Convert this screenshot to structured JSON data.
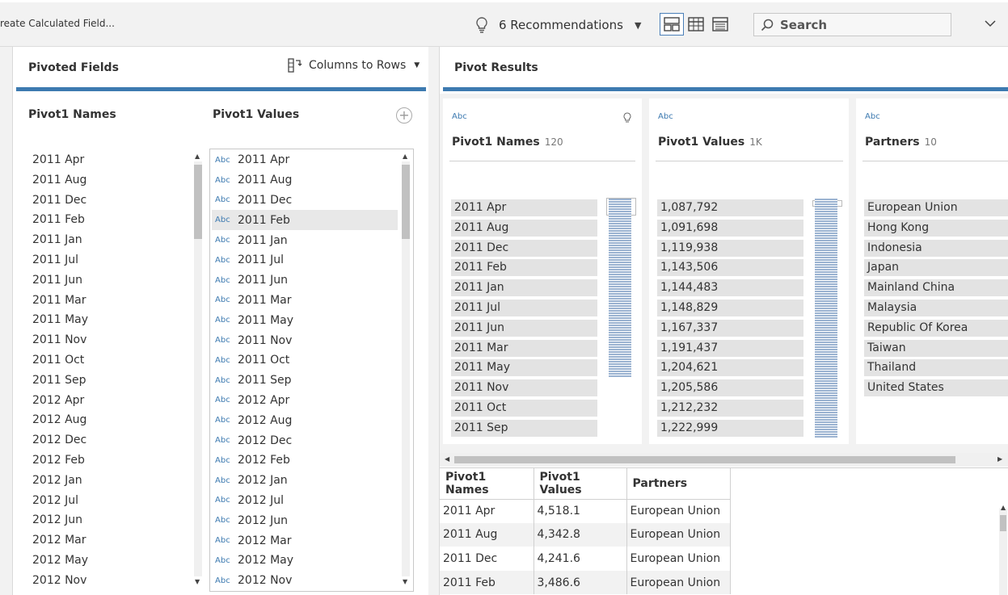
{
  "toolbar": {
    "calc_label": "reate Calculated Field...",
    "recommendations": "6 Recommendations",
    "search_placeholder": "Search"
  },
  "left_pane": {
    "title": "Pivoted Fields",
    "pivot_type": "Columns to Rows",
    "names_header": "Pivot1 Names",
    "values_header": "Pivot1 Values",
    "names": [
      "2011 Apr",
      "2011 Aug",
      "2011 Dec",
      "2011 Feb",
      "2011 Jan",
      "2011 Jul",
      "2011 Jun",
      "2011 Mar",
      "2011 May",
      "2011 Nov",
      "2011 Oct",
      "2011 Sep",
      "2012 Apr",
      "2012 Aug",
      "2012 Dec",
      "2012 Feb",
      "2012 Jan",
      "2012 Jul",
      "2012 Jun",
      "2012 Mar",
      "2012 May",
      "2012 Nov"
    ],
    "values": [
      {
        "type": "Abc",
        "label": "2011 Apr"
      },
      {
        "type": "Abc",
        "label": "2011 Aug"
      },
      {
        "type": "Abc",
        "label": "2011 Dec"
      },
      {
        "type": "Abc",
        "label": "2011 Feb",
        "selected": true
      },
      {
        "type": "Abc",
        "label": "2011 Jan"
      },
      {
        "type": "Abc",
        "label": "2011 Jul"
      },
      {
        "type": "Abc",
        "label": "2011 Jun"
      },
      {
        "type": "Abc",
        "label": "2011 Mar"
      },
      {
        "type": "Abc",
        "label": "2011 May"
      },
      {
        "type": "Abc",
        "label": "2011 Nov"
      },
      {
        "type": "Abc",
        "label": "2011 Oct"
      },
      {
        "type": "Abc",
        "label": "2011 Sep"
      },
      {
        "type": "Abc",
        "label": "2012 Apr"
      },
      {
        "type": "Abc",
        "label": "2012 Aug"
      },
      {
        "type": "Abc",
        "label": "2012 Dec"
      },
      {
        "type": "Abc",
        "label": "2012 Feb"
      },
      {
        "type": "Abc",
        "label": "2012 Jan"
      },
      {
        "type": "Abc",
        "label": "2012 Jul"
      },
      {
        "type": "Abc",
        "label": "2012 Jun"
      },
      {
        "type": "Abc",
        "label": "2012 Mar"
      },
      {
        "type": "Abc",
        "label": "2012 May"
      },
      {
        "type": "Abc",
        "label": "2012 Nov"
      }
    ]
  },
  "right_pane": {
    "title": "Pivot Results",
    "cards": [
      {
        "type": "Abc",
        "name": "Pivot1 Names",
        "count": "120",
        "values": [
          "2011 Apr",
          "2011 Aug",
          "2011 Dec",
          "2011 Feb",
          "2011 Jan",
          "2011 Jul",
          "2011 Jun",
          "2011 Mar",
          "2011 May",
          "2011 Nov",
          "2011 Oct",
          "2011 Sep"
        ]
      },
      {
        "type": "Abc",
        "name": "Pivot1 Values",
        "count": "1K",
        "values": [
          "1,087,792",
          "1,091,698",
          "1,119,938",
          "1,143,506",
          "1,144,483",
          "1,148,829",
          "1,167,337",
          "1,191,437",
          "1,204,621",
          "1,205,586",
          "1,212,232",
          "1,222,999"
        ]
      },
      {
        "type": "Abc",
        "name": "Partners",
        "count": "10",
        "values": [
          "European Union",
          "Hong Kong",
          "Indonesia",
          "Japan",
          "Mainland China",
          "Malaysia",
          "Republic Of Korea",
          "Taiwan",
          "Thailand",
          "United States"
        ]
      }
    ],
    "grid": {
      "headers": [
        "Pivot1 Names",
        "Pivot1 Values",
        "Partners"
      ],
      "rows": [
        [
          "2011 Apr",
          "4,518.1",
          "European Union"
        ],
        [
          "2011 Aug",
          "4,342.8",
          "European Union"
        ],
        [
          "2011 Dec",
          "4,241.6",
          "European Union"
        ],
        [
          "2011 Feb",
          "3,486.6",
          "European Union"
        ]
      ]
    }
  },
  "colors": {
    "accent": "#3d7ab0",
    "type_label": "#3d7ab0",
    "histogram": "#9bb3d1"
  }
}
